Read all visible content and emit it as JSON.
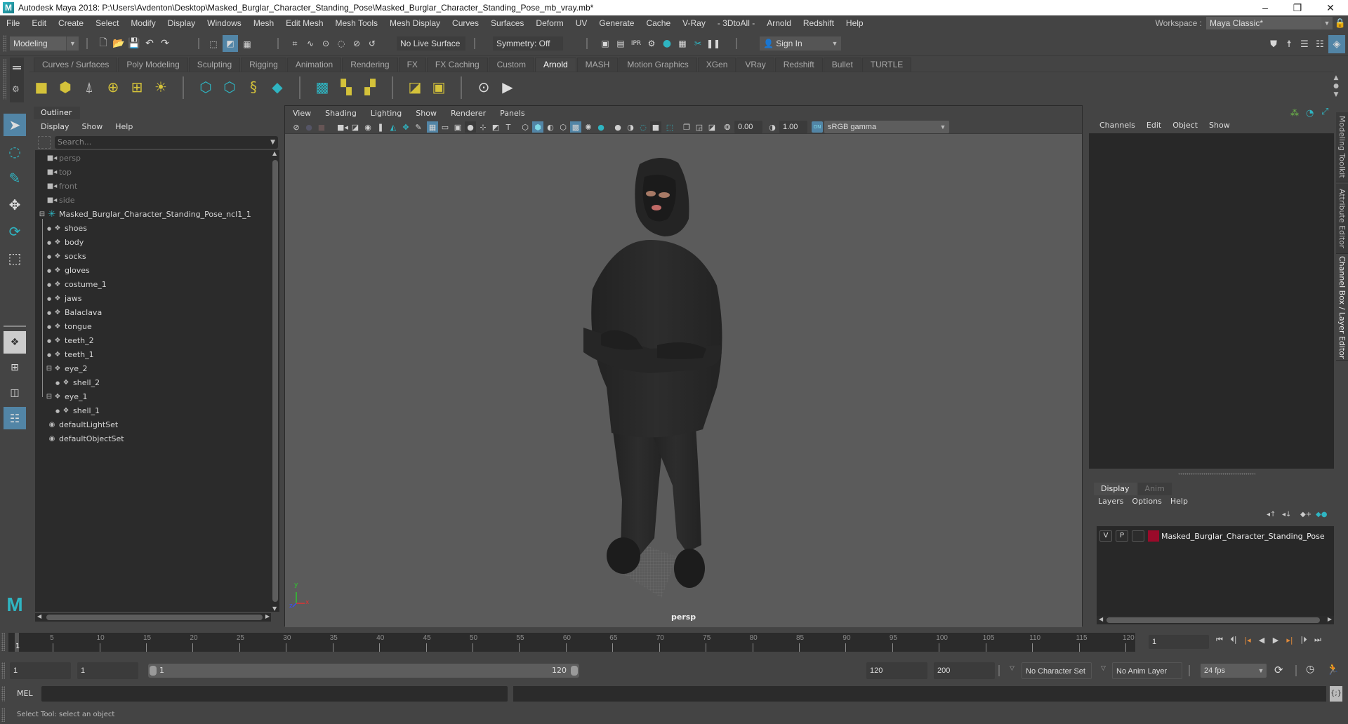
{
  "window": {
    "title": "Autodesk Maya 2018: P:\\Users\\Avdenton\\Desktop\\Masked_Burglar_Character_Standing_Pose\\Masked_Burglar_Character_Standing_Pose_mb_vray.mb*",
    "logo": "M",
    "minimize": "–",
    "restore": "❐",
    "close": "✕"
  },
  "menubar": {
    "items": [
      "File",
      "Edit",
      "Create",
      "Select",
      "Modify",
      "Display",
      "Windows",
      "Mesh",
      "Edit Mesh",
      "Mesh Tools",
      "Mesh Display",
      "Curves",
      "Surfaces",
      "Deform",
      "UV",
      "Generate",
      "Cache",
      "V-Ray",
      "- 3DtoAll -",
      "Arnold",
      "Redshift",
      "Help"
    ],
    "workspace_label": "Workspace :",
    "workspace_value": "Maya Classic*"
  },
  "statusline": {
    "menuset": "Modeling",
    "live_surface": "No Live Surface",
    "symmetry": "Symmetry: Off",
    "sign_in": "Sign In"
  },
  "shelf": {
    "tabs": [
      "Curves / Surfaces",
      "Poly Modeling",
      "Sculpting",
      "Rigging",
      "Animation",
      "Rendering",
      "FX",
      "FX Caching",
      "Custom",
      "Arnold",
      "MASH",
      "Motion Graphics",
      "XGen",
      "VRay",
      "Redshift",
      "Bullet",
      "TURTLE"
    ],
    "active_tab": "Arnold"
  },
  "outliner": {
    "title": "Outliner",
    "menu": [
      "Display",
      "Show",
      "Help"
    ],
    "search_placeholder": "Search...",
    "items": [
      {
        "label": "persp",
        "type": "camera",
        "depth": 0,
        "dim": true
      },
      {
        "label": "top",
        "type": "camera",
        "depth": 0,
        "dim": true
      },
      {
        "label": "front",
        "type": "camera",
        "depth": 0,
        "dim": true
      },
      {
        "label": "side",
        "type": "camera",
        "depth": 0,
        "dim": true
      },
      {
        "label": "Masked_Burglar_Character_Standing_Pose_ncl1_1",
        "type": "group",
        "depth": 0,
        "expanded": true
      },
      {
        "label": "shoes",
        "type": "mesh",
        "depth": 1
      },
      {
        "label": "body",
        "type": "mesh",
        "depth": 1
      },
      {
        "label": "socks",
        "type": "mesh",
        "depth": 1
      },
      {
        "label": "gloves",
        "type": "mesh",
        "depth": 1
      },
      {
        "label": "costume_1",
        "type": "mesh",
        "depth": 1
      },
      {
        "label": "jaws",
        "type": "mesh",
        "depth": 1
      },
      {
        "label": "Balaclava",
        "type": "mesh",
        "depth": 1
      },
      {
        "label": "tongue",
        "type": "mesh",
        "depth": 1
      },
      {
        "label": "teeth_2",
        "type": "mesh",
        "depth": 1
      },
      {
        "label": "teeth_1",
        "type": "mesh",
        "depth": 1
      },
      {
        "label": "eye_2",
        "type": "mesh",
        "depth": 1,
        "expanded": true
      },
      {
        "label": "shell_2",
        "type": "mesh",
        "depth": 2
      },
      {
        "label": "eye_1",
        "type": "mesh",
        "depth": 1,
        "expanded": true
      },
      {
        "label": "shell_1",
        "type": "mesh",
        "depth": 2
      },
      {
        "label": "defaultLightSet",
        "type": "set",
        "depth": 0
      },
      {
        "label": "defaultObjectSet",
        "type": "set",
        "depth": 0
      }
    ]
  },
  "viewport": {
    "menu": [
      "View",
      "Shading",
      "Lighting",
      "Show",
      "Renderer",
      "Panels"
    ],
    "exposure": "0.00",
    "gamma": "1.00",
    "color_mgmt": "ON",
    "color_space": "sRGB gamma",
    "camera_label": "persp",
    "axis": {
      "x": "x",
      "y": "y",
      "z": "z"
    }
  },
  "channelbox": {
    "menu": [
      "Channels",
      "Edit",
      "Object",
      "Show"
    ]
  },
  "layer_editor": {
    "tabs": [
      "Display",
      "Anim"
    ],
    "active_tab": "Display",
    "menu": [
      "Layers",
      "Options",
      "Help"
    ],
    "layers": [
      {
        "visible": "V",
        "playback": "P",
        "name": "Masked_Burglar_Character_Standing_Pose",
        "color": "#9a0a2a"
      }
    ]
  },
  "side_tabs": [
    "Modeling Toolkit",
    "Attribute Editor",
    "Channel Box / Layer Editor"
  ],
  "timeline": {
    "ticks": [
      5,
      10,
      15,
      20,
      25,
      30,
      35,
      40,
      45,
      50,
      55,
      60,
      65,
      70,
      75,
      80,
      85,
      90,
      95,
      100,
      105,
      110,
      115,
      120
    ],
    "current_frame": "1",
    "current_frame_field": "1",
    "range_min": 1,
    "range_max": 120,
    "start_field": "1",
    "playback_start": "1",
    "range_start_label": "1",
    "range_end_label": "120",
    "playback_end": "120",
    "end_field": "200",
    "character_set": "No Character Set",
    "anim_layer": "No Anim Layer",
    "fps": "24 fps"
  },
  "command_line": {
    "label": "MEL"
  },
  "help_line": {
    "text": "Select Tool: select an object"
  },
  "colors": {
    "accent_blue": "#5285a6",
    "maya_teal": "#2fb5c2",
    "arnold_yellow": "#d4c23a",
    "layer_red": "#9a0a2a",
    "playback_orange": "#e08a3a"
  }
}
